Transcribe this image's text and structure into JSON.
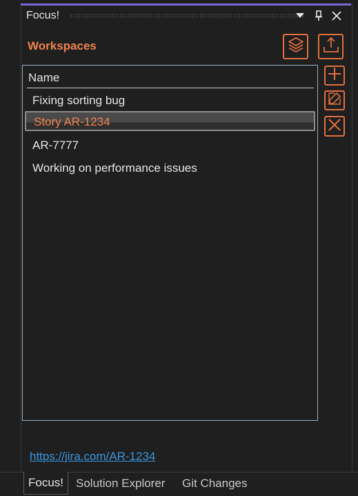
{
  "window": {
    "title": "Focus!",
    "dropdown_icon": "chevron-down-icon",
    "pin_icon": "pin-icon",
    "close_icon": "close-icon"
  },
  "workspaces": {
    "header": "Workspaces",
    "toolbar": {
      "layers_icon": "layers-icon",
      "export_icon": "export-icon"
    },
    "list": {
      "column_header": "Name",
      "items": [
        "Fixing sorting bug",
        "Story AR-1234",
        "AR-7777",
        "Working on performance issues"
      ],
      "selected_index": 1
    },
    "side_buttons": {
      "add_icon": "plus-icon",
      "edit_icon": "edit-icon",
      "delete_icon": "x-icon"
    },
    "link": "https://jira.com/AR-1234"
  },
  "bottom_tabs": [
    "Focus!",
    "Solution Explorer",
    "Git Changes"
  ],
  "colors": {
    "accent": "#f0834f",
    "title_accent": "#7b6bd6",
    "link": "#3a96dd",
    "background": "#1f1f1f"
  }
}
